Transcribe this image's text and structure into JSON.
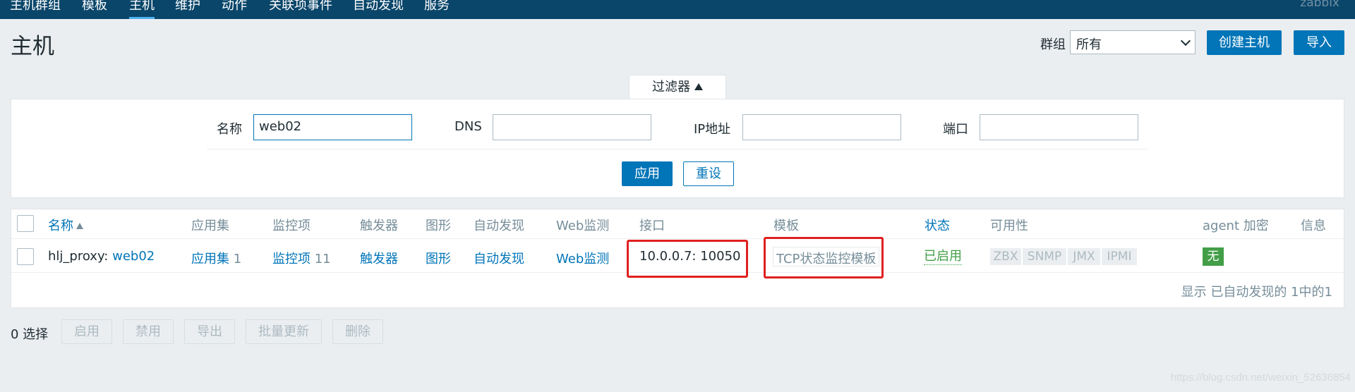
{
  "nav": {
    "items": [
      "主机群组",
      "模板",
      "主机",
      "维护",
      "动作",
      "关联项事件",
      "自动发现",
      "服务"
    ],
    "active_index": 2,
    "brand": "zabbix"
  },
  "header": {
    "title": "主机",
    "group_label": "群组",
    "group_value": "所有",
    "create_button": "创建主机",
    "import_button": "导入"
  },
  "filter": {
    "tab_label": "过滤器",
    "name_label": "名称",
    "name_value": "web02",
    "dns_label": "DNS",
    "dns_value": "",
    "ip_label": "IP地址",
    "ip_value": "",
    "port_label": "端口",
    "port_value": "",
    "apply_button": "应用",
    "reset_button": "重设"
  },
  "table": {
    "headers": {
      "name": "名称",
      "apps": "应用集",
      "items": "监控项",
      "triggers": "触发器",
      "graphs": "图形",
      "discovery": "自动发现",
      "web": "Web监测",
      "interface": "接口",
      "templates": "模板",
      "status": "状态",
      "availability": "可用性",
      "agent_encryption": "agent 加密",
      "info": "信息"
    },
    "row": {
      "proxy": "hlj_proxy:",
      "host": "web02",
      "apps_label": "应用集",
      "apps_count": "1",
      "items_label": "监控项",
      "items_count": "11",
      "triggers": "触发器",
      "graphs": "图形",
      "discovery": "自动发现",
      "web": "Web监测",
      "interface": "10.0.0.7: 10050",
      "template": "TCP状态监控模板",
      "status": "已启用",
      "availability": [
        "ZBX",
        "SNMP",
        "JMX",
        "IPMI"
      ],
      "encryption": "无"
    },
    "footer": "显示 已自动发现的 1中的1"
  },
  "actions": {
    "selected": "0 选择",
    "enable": "启用",
    "disable": "禁用",
    "export": "导出",
    "mass_update": "批量更新",
    "delete": "删除"
  },
  "watermark": "https://blog.csdn.net/weixin_52636854",
  "colors": {
    "nav_bg": "#0a466a",
    "accent": "#0275b8",
    "enabled": "#429e47",
    "highlight": "#e02020"
  }
}
